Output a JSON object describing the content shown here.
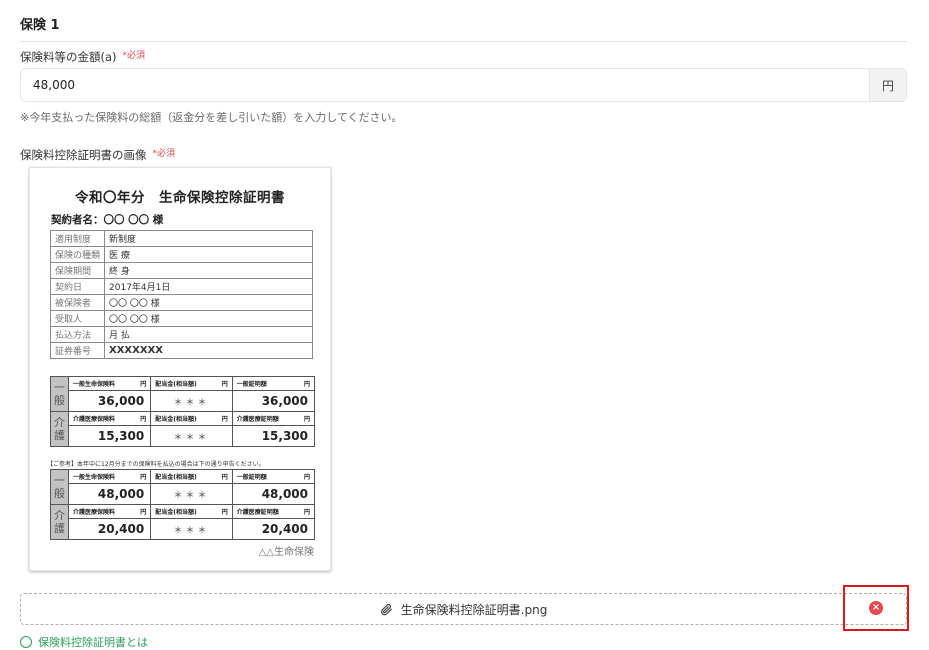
{
  "section": {
    "title": "保険 1"
  },
  "premium": {
    "label": "保険料等の金額(a)",
    "required": "*必須",
    "value": "48,000",
    "unit": "円",
    "hint": "※今年支払った保険料の総額（返金分を差し引いた額）を入力してください。"
  },
  "image_field": {
    "label": "保険料控除証明書の画像",
    "required": "*必須"
  },
  "certificate": {
    "title": "令和〇年分　生命保険控除証明書",
    "contractor": "契約者名：〇〇 〇〇 様",
    "rows": [
      {
        "key": "適用制度",
        "value": "新制度"
      },
      {
        "key": "保険の種類",
        "value": "医 療"
      },
      {
        "key": "保険期間",
        "value": "終 身"
      },
      {
        "key": "契約日",
        "value": "2017年4月1日"
      },
      {
        "key": "被保険者",
        "value": "〇〇 〇〇 様"
      },
      {
        "key": "受取人",
        "value": "〇〇 〇〇 様"
      },
      {
        "key": "払込方法",
        "value": "月 払"
      },
      {
        "key": "証券番号",
        "value": "XXXXXXX"
      }
    ],
    "headers": {
      "general_premium": "一般生命保険料",
      "dividend": "配当金(相当額)",
      "general_proof": "一般証明額",
      "care_premium": "介護医療保険料",
      "care_proof": "介護医療証明額",
      "yen": "円"
    },
    "block1": {
      "general_side": "一般",
      "care_side": "介護",
      "general_premium": "36,000",
      "general_dividend": "＊＊＊",
      "general_proof": "36,000",
      "care_premium": "15,300",
      "care_dividend": "＊＊＊",
      "care_proof": "15,300"
    },
    "reference_note": "【ご参考】本年中に12月分までの保険料を払込の場合は下の通り申告ください。",
    "block2": {
      "general_side": "一般",
      "care_side": "介護",
      "general_premium": "48,000",
      "general_dividend": "＊＊＊",
      "general_proof": "48,000",
      "care_premium": "20,400",
      "care_dividend": "＊＊＊",
      "care_proof": "20,400"
    },
    "issuer": "△△生命保険"
  },
  "attachment": {
    "file_name": "生命保険料控除証明書.png",
    "clip_icon": "paperclip-icon",
    "remove_icon": "close-circle-icon",
    "remove_symbol": "×"
  },
  "next_link": {
    "label": "保険料控除証明書とは"
  },
  "colors": {
    "required": "#e5484d",
    "highlight": "#e0161d",
    "link": "#2e9e5b"
  }
}
